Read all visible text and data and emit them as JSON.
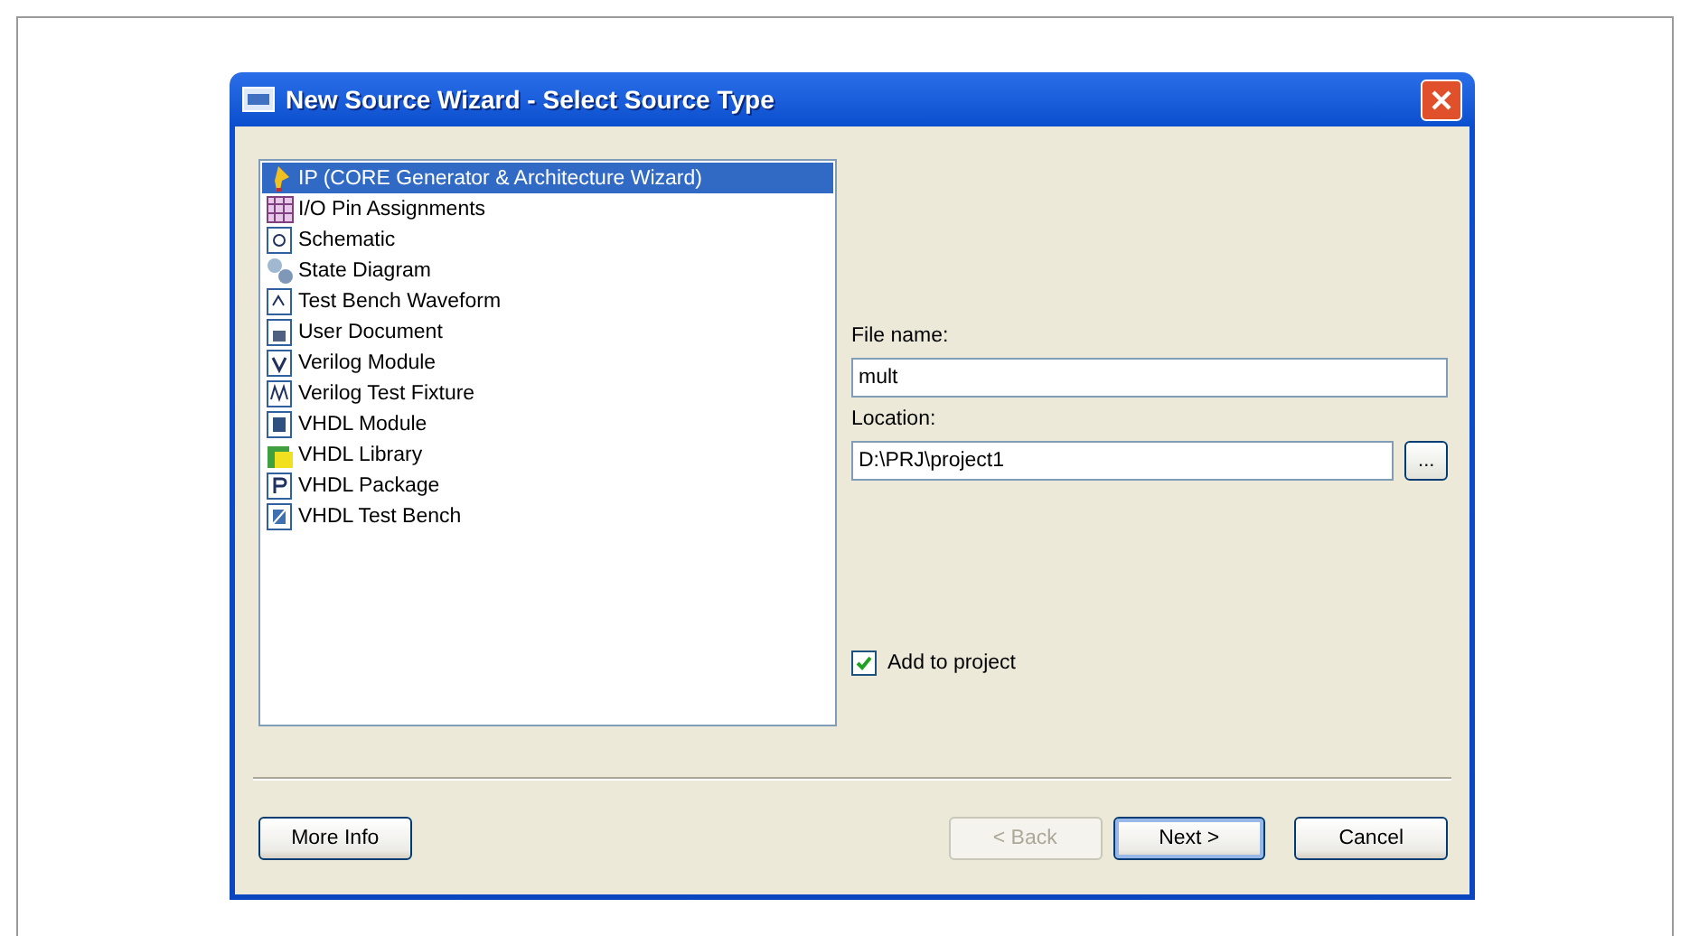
{
  "window": {
    "title": "New Source Wizard - Select Source Type"
  },
  "source_types": [
    {
      "label": "IP (CORE Generator & Architecture Wizard)",
      "selected": true
    },
    {
      "label": "I/O Pin Assignments",
      "selected": false
    },
    {
      "label": "Schematic",
      "selected": false
    },
    {
      "label": "State Diagram",
      "selected": false
    },
    {
      "label": "Test Bench Waveform",
      "selected": false
    },
    {
      "label": "User Document",
      "selected": false
    },
    {
      "label": "Verilog Module",
      "selected": false
    },
    {
      "label": "Verilog Test Fixture",
      "selected": false
    },
    {
      "label": "VHDL Module",
      "selected": false
    },
    {
      "label": "VHDL Library",
      "selected": false
    },
    {
      "label": "VHDL Package",
      "selected": false
    },
    {
      "label": "VHDL Test Bench",
      "selected": false
    }
  ],
  "file_name": {
    "label": "File name:",
    "value": "mult"
  },
  "location": {
    "label": "Location:",
    "value": "D:\\PRJ\\project1",
    "browse": "..."
  },
  "add_to_project": {
    "label": "Add to project",
    "checked": true
  },
  "buttons": [
    {
      "label": "More Info",
      "disabled": false,
      "default": false
    },
    {
      "label": "< Back",
      "disabled": true,
      "default": false
    },
    {
      "label": "Next >",
      "disabled": false,
      "default": true
    },
    {
      "label": "Cancel",
      "disabled": false,
      "default": false
    }
  ]
}
